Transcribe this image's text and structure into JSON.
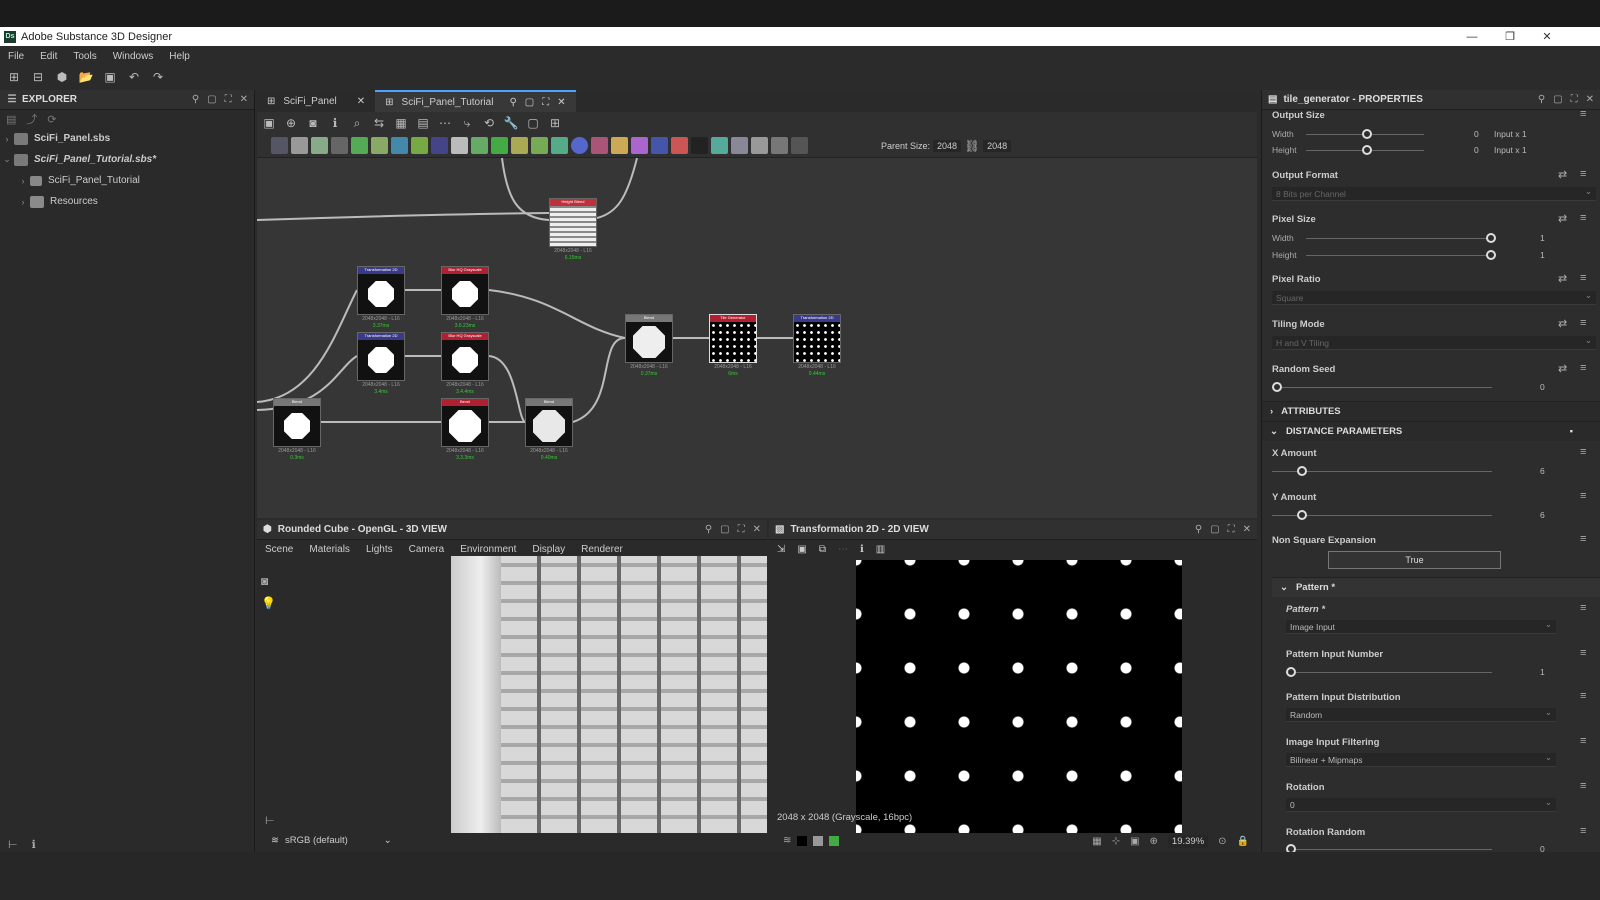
{
  "app": {
    "title": "Adobe Substance 3D Designer",
    "logo": "Ds"
  },
  "menu": [
    "File",
    "Edit",
    "Tools",
    "Windows",
    "Help"
  ],
  "explorer": {
    "title": "EXPLORER",
    "items": [
      {
        "label": "SciFi_Panel.sbs",
        "depth": 0,
        "bold": true
      },
      {
        "label": "SciFi_Panel_Tutorial.sbs*",
        "depth": 0,
        "bold": true
      },
      {
        "label": "SciFi_Panel_Tutorial",
        "depth": 1,
        "bold": false
      },
      {
        "label": "Resources",
        "depth": 1,
        "bold": false
      }
    ]
  },
  "graph": {
    "tabs": [
      {
        "label": "SciFi_Panel",
        "active": false
      },
      {
        "label": "SciFi_Panel_Tutorial",
        "active": true
      }
    ],
    "parent_size_label": "Parent Size:",
    "parent_size_w": "2048",
    "parent_size_h": "2048",
    "nodes": [
      {
        "title": "Height Blend",
        "res": "2048x2048 - L16",
        "time": "6.15ms",
        "hdr": "#c0303a",
        "kind": "pattern"
      },
      {
        "title": "Transformation 2D",
        "res": "2048x2048 - L16",
        "time": "3.37ms",
        "hdr": "#3a3a8a",
        "kind": "oct"
      },
      {
        "title": "Blur HQ Grayscale",
        "res": "2048x2048 - L16",
        "time": "3.6.23ms",
        "hdr": "#b02030",
        "kind": "oct"
      },
      {
        "title": "Transformation 2D",
        "res": "2048x2048 - L16",
        "time": "3.4ms",
        "hdr": "#3a3a8a",
        "kind": "oct"
      },
      {
        "title": "Blur HQ Grayscale",
        "res": "2048x2048 - L16",
        "time": "3.4.4ms",
        "hdr": "#b02030",
        "kind": "oct"
      },
      {
        "title": "Blend",
        "res": "2048x2048 - L16",
        "time": "0.3ms",
        "hdr": "#777",
        "kind": "oct"
      },
      {
        "title": "Bevel",
        "res": "2048x2048 - L16",
        "time": "3.3.3ms",
        "hdr": "#b02030",
        "kind": "oct"
      },
      {
        "title": "Blend",
        "res": "2048x2048 - L16",
        "time": "0.40ms",
        "hdr": "#777",
        "kind": "oct"
      },
      {
        "title": "Blend",
        "res": "2048x2048 - L16",
        "time": "0.37ms",
        "hdr": "#777",
        "kind": "oct"
      },
      {
        "title": "Tile Generator",
        "res": "2048x2048 - L16",
        "time": "6ms",
        "hdr": "#b02030",
        "kind": "dots"
      },
      {
        "title": "Transformation 2D",
        "res": "2048x2048 - L16",
        "time": "0.44ms",
        "hdr": "#3a3a8a",
        "kind": "dots"
      }
    ]
  },
  "view3d": {
    "title": "Rounded Cube - OpenGL - 3D VIEW",
    "menu": [
      "Scene",
      "Materials",
      "Lights",
      "Camera",
      "Environment",
      "Display",
      "Renderer"
    ],
    "colorspace": "sRGB (default)"
  },
  "view2d": {
    "title": "Transformation 2D - 2D VIEW",
    "info": "2048 x 2048 (Grayscale, 16bpc)",
    "zoom": "19.39%"
  },
  "props": {
    "title": "tile_generator - PROPERTIES",
    "output_size": {
      "label": "Output Size",
      "width_label": "Width",
      "height_label": "Height",
      "width_val": "0",
      "height_val": "0",
      "width_mode": "Input x 1",
      "height_mode": "Input x 1"
    },
    "output_format": {
      "label": "Output Format",
      "value": "8 Bits per Channel"
    },
    "pixel_size": {
      "label": "Pixel Size",
      "width_label": "Width",
      "height_label": "Height",
      "width_val": "1",
      "height_val": "1"
    },
    "pixel_ratio": {
      "label": "Pixel Ratio",
      "value": "Square"
    },
    "tiling_mode": {
      "label": "Tiling Mode",
      "value": "H and V Tiling"
    },
    "random_seed": {
      "label": "Random Seed",
      "value": "0"
    },
    "attributes": "ATTRIBUTES",
    "distance_params": "DISTANCE PARAMETERS",
    "x_amount": {
      "label": "X Amount",
      "value": "6",
      "fraction": 0.12
    },
    "y_amount": {
      "label": "Y Amount",
      "value": "6",
      "fraction": 0.12
    },
    "non_square": {
      "label": "Non Square Expansion",
      "value": "True"
    },
    "pattern_section": "Pattern *",
    "pattern": {
      "label": "Pattern *",
      "value": "Image Input"
    },
    "pattern_input_number": {
      "label": "Pattern Input Number",
      "value": "1"
    },
    "pattern_input_distribution": {
      "label": "Pattern Input Distribution",
      "value": "Random"
    },
    "image_input_filtering": {
      "label": "Image Input Filtering",
      "value": "Bilinear + Mipmaps"
    },
    "rotation": {
      "label": "Rotation",
      "value": "0"
    },
    "rotation_random": {
      "label": "Rotation Random",
      "value": "0"
    }
  }
}
